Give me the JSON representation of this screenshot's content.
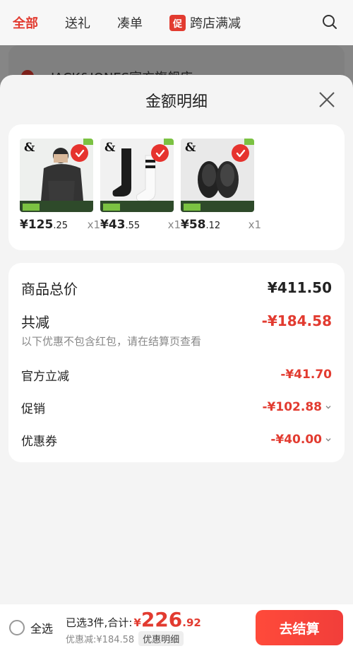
{
  "colors": {
    "accent": "#e23b30",
    "muted": "#888888"
  },
  "background_tabs": {
    "items": [
      {
        "label": "全部",
        "active": true
      },
      {
        "label": "送礼",
        "active": false
      },
      {
        "label": "凑单",
        "active": false
      },
      {
        "label": "跨店满减",
        "badge": "促",
        "active": false
      }
    ],
    "search_icon": "search-icon",
    "store_name": "JACK&JONES官方旗舰店"
  },
  "sheet": {
    "title": "金额明细",
    "close_icon": "close-icon",
    "products": [
      {
        "name": "polo shirt",
        "brand_mark": "&",
        "price_int": "¥125",
        "price_dec": ".25",
        "qty": "x1",
        "selected": true
      },
      {
        "name": "socks",
        "brand_mark": "&",
        "price_int": "¥43",
        "price_dec": ".55",
        "qty": "x1",
        "selected": true
      },
      {
        "name": "slides",
        "brand_mark": "&",
        "price_int": "¥58",
        "price_dec": ".12",
        "qty": "x1",
        "selected": true
      }
    ],
    "detail": {
      "total_label": "商品总价",
      "total_value": "¥411.50",
      "reduce_label": "共减",
      "reduce_value": "-¥184.58",
      "reduce_note": "以下优惠不包含红包，请在结算页查看",
      "items": [
        {
          "label": "官方立减",
          "value": "-¥41.70",
          "expandable": false
        },
        {
          "label": "促销",
          "value": "-¥102.88",
          "expandable": true
        },
        {
          "label": "优惠券",
          "value": "-¥40.00",
          "expandable": true
        }
      ]
    }
  },
  "bottom_bar": {
    "select_all": "全选",
    "selected_text": "已选3件,合计:",
    "total_currency": "¥",
    "total_int": "226",
    "total_dec": ".92",
    "discount_text": "优惠减:¥184.58",
    "detail_chip": "优惠明细",
    "checkout": "去结算"
  }
}
